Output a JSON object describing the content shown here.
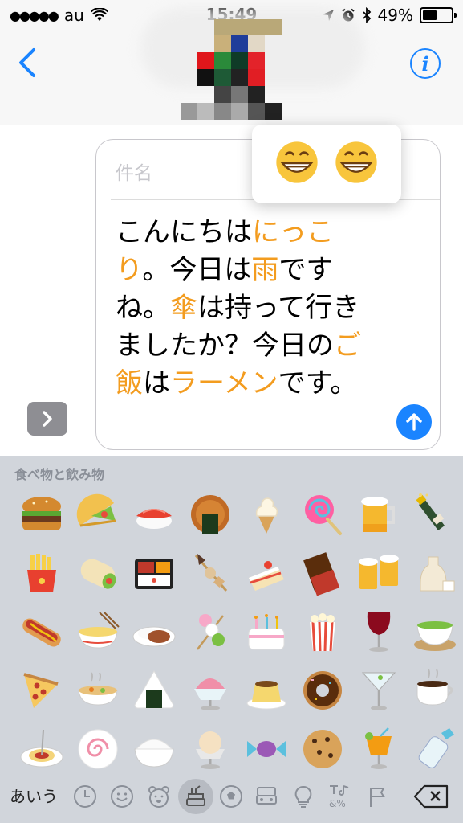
{
  "status_bar": {
    "carrier": "au",
    "time": "15:49",
    "battery_percent": "49%",
    "battery_level": 0.49
  },
  "nav": {
    "back_icon": "chevron-left-icon",
    "info_icon": "info-icon"
  },
  "compose": {
    "subject_placeholder": "件名",
    "message_parts": [
      {
        "text": "こんにちは",
        "hl": false
      },
      {
        "text": "にっこり",
        "hl": true
      },
      {
        "text": "。今日は",
        "hl": false
      },
      {
        "text": "雨",
        "hl": true
      },
      {
        "text": "ですね。",
        "hl": false
      },
      {
        "text": "傘",
        "hl": true
      },
      {
        "text": "は持って行きましたか？今日の",
        "hl": false
      },
      {
        "text": "ご飯",
        "hl": true
      },
      {
        "text": "は",
        "hl": false
      },
      {
        "text": "ラーメン",
        "hl": true
      },
      {
        "text": "です。",
        "hl": false
      }
    ],
    "highlight_color": "#f39c1f"
  },
  "suggestions": [
    "grinning-face-emoji",
    "grinning-face-emoji"
  ],
  "keyboard": {
    "category_label": "食べ物と飲み物",
    "emojis": [
      "hamburger",
      "taco",
      "sushi",
      "rice-cracker",
      "soft-ice-cream",
      "lollipop",
      "beer-mug",
      "champagne",
      "french-fries",
      "burrito",
      "bento-box",
      "oden",
      "shortcake",
      "chocolate-bar",
      "clinking-beers",
      "sake",
      "hot-dog",
      "ramen",
      "curry-rice",
      "dango",
      "birthday-cake",
      "popcorn",
      "wine-glass",
      "matcha",
      "pizza",
      "stew",
      "rice-ball",
      "shaved-ice",
      "custard",
      "doughnut",
      "cocktail",
      "coffee",
      "spaghetti",
      "fish-cake",
      "cooked-rice",
      "ice-cream",
      "candy",
      "cookie",
      "tropical-drink",
      "baby-bottle"
    ],
    "abc_label": "あいう",
    "bottom_icons": [
      "clock-icon",
      "smiley-icon",
      "bear-icon",
      "food-icon",
      "soccer-icon",
      "car-icon",
      "bulb-icon",
      "symbols-icon",
      "flag-icon"
    ]
  }
}
